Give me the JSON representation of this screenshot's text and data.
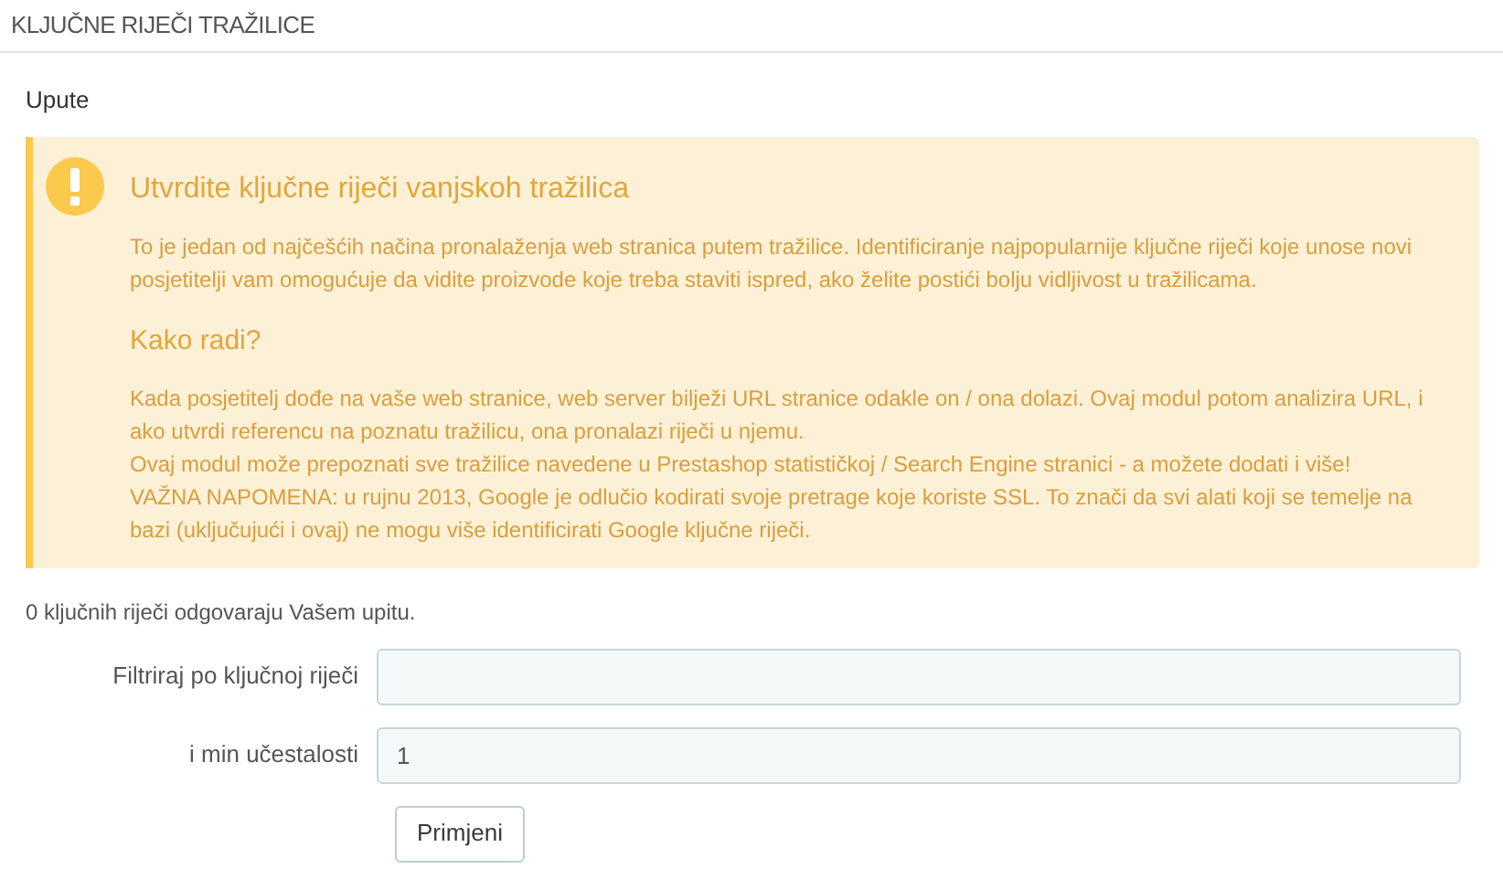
{
  "panel_title": "KLJUČNE RIJEČI TRAŽILICE",
  "section_title": "Upute",
  "alert": {
    "title": "Utvrdite ključne riječi vanjskoh tražilica",
    "intro": "To je jedan od najčešćih načina pronalaženja web stranica putem tražilice. Identificiranje najpopularnije ključne riječi koje unose novi posjetitelji vam omogućuje da vidite proizvode koje treba staviti ispred, ako želite postići bolju vidljivost u tražilicama.",
    "subtitle": "Kako radi?",
    "paragraphs": [
      "Kada posjetitelj dođe na vaše web stranice, web server bilježi URL stranice odakle on / ona dolazi. Ovaj modul potom analizira URL, i ako utvrdi referencu na poznatu tražilicu, ona pronalazi riječi u njemu.",
      "Ovaj modul može prepoznati sve tražilice navedene u Prestashop statističkoj / Search Engine stranici - a možete dodati i više!",
      "VAŽNA NAPOMENA: u rujnu 2013, Google je odlučio kodirati svoje pretrage koje koriste SSL. To znači da svi alati koji se temelje na bazi (uključujući i ovaj) ne mogu više identificirati Google ključne riječi."
    ]
  },
  "result_text": "0 ključnih riječi odgovaraju Vašem upitu.",
  "fields": [
    {
      "label": "Filtriraj po ključnoj riječi"
    },
    {
      "label": "i min učestalosti",
      "value": "1"
    }
  ],
  "apply_button": "Primjeni"
}
